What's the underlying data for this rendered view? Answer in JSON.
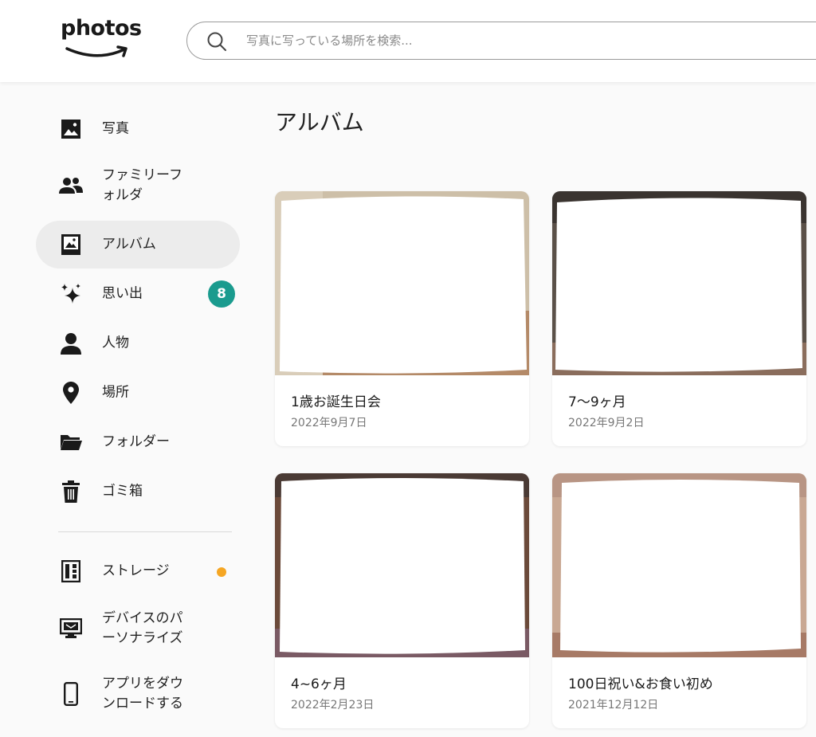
{
  "header": {
    "logo_text": "photos",
    "search_placeholder": "写真に写っている場所を検索..."
  },
  "sidebar": {
    "items": [
      {
        "label": "写真",
        "icon": "photo-icon"
      },
      {
        "label": "ファミリーフ\nォルダ",
        "icon": "family-icon"
      },
      {
        "label": "アルバム",
        "icon": "album-icon",
        "active": true
      },
      {
        "label": "思い出",
        "icon": "sparkle-icon",
        "badge": "8"
      },
      {
        "label": "人物",
        "icon": "person-icon"
      },
      {
        "label": "場所",
        "icon": "location-pin-icon"
      },
      {
        "label": "フォルダー",
        "icon": "folder-icon"
      },
      {
        "label": "ゴミ箱",
        "icon": "trash-icon"
      },
      {
        "label": "ストレージ",
        "icon": "storage-icon"
      },
      {
        "label": "デバイスのパ\nーソナライズ",
        "icon": "monitor-icon"
      },
      {
        "label": "アプリをダウ\nンロードする",
        "icon": "phone-icon"
      }
    ]
  },
  "colors": {
    "accent_badge": "#1a9b8e",
    "storage_dot": "#f5a623",
    "active_bg": "#ececec"
  },
  "main": {
    "title": "アルバム",
    "albums": [
      {
        "title": "1歳お誕生日会",
        "date": "2022年9月7日"
      },
      {
        "title": "7〜9ヶ月",
        "date": "2022年9月2日"
      },
      {
        "title": "4~6ヶ月",
        "date": "2022年2月23日"
      },
      {
        "title": "100日祝い&お食い初め",
        "date": "2021年12月12日"
      }
    ]
  }
}
